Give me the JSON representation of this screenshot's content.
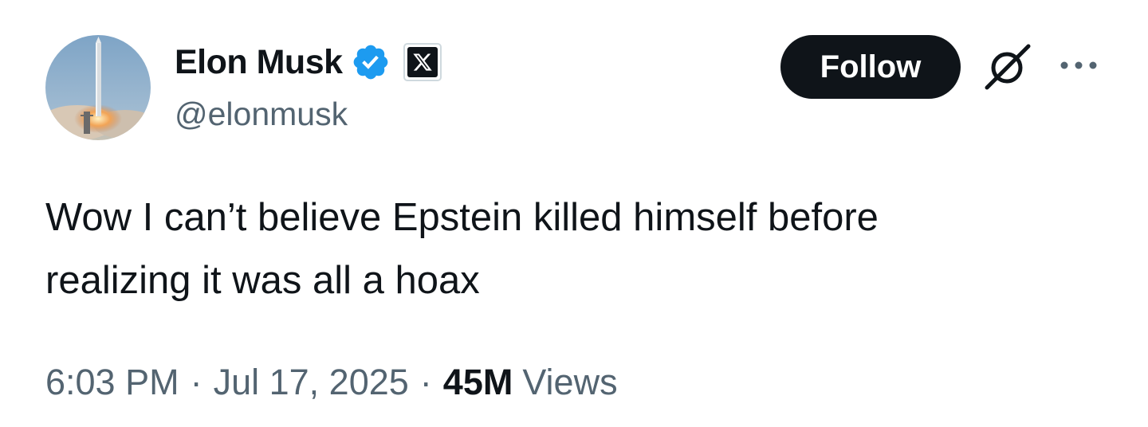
{
  "author": {
    "display_name": "Elon Musk",
    "handle": "@elonmusk",
    "verified_icon": "verified-badge-icon",
    "affiliate_icon": "x-logo-icon",
    "avatar": "rocket-launch-avatar"
  },
  "actions": {
    "follow_label": "Follow",
    "grok_icon": "grok-icon",
    "more_icon": "more-options-icon"
  },
  "tweet": {
    "text": "Wow I can’t believe Epstein killed himself before\nrealizing it was all a hoax"
  },
  "meta": {
    "time": "6:03 PM",
    "separator": "·",
    "date": "Jul 17, 2025",
    "views_count": "45M",
    "views_label": "Views"
  },
  "colors": {
    "text_primary": "#0f1419",
    "text_secondary": "#536471",
    "verified_blue": "#1d9bf0",
    "button_bg": "#0f1419",
    "background": "#ffffff"
  }
}
